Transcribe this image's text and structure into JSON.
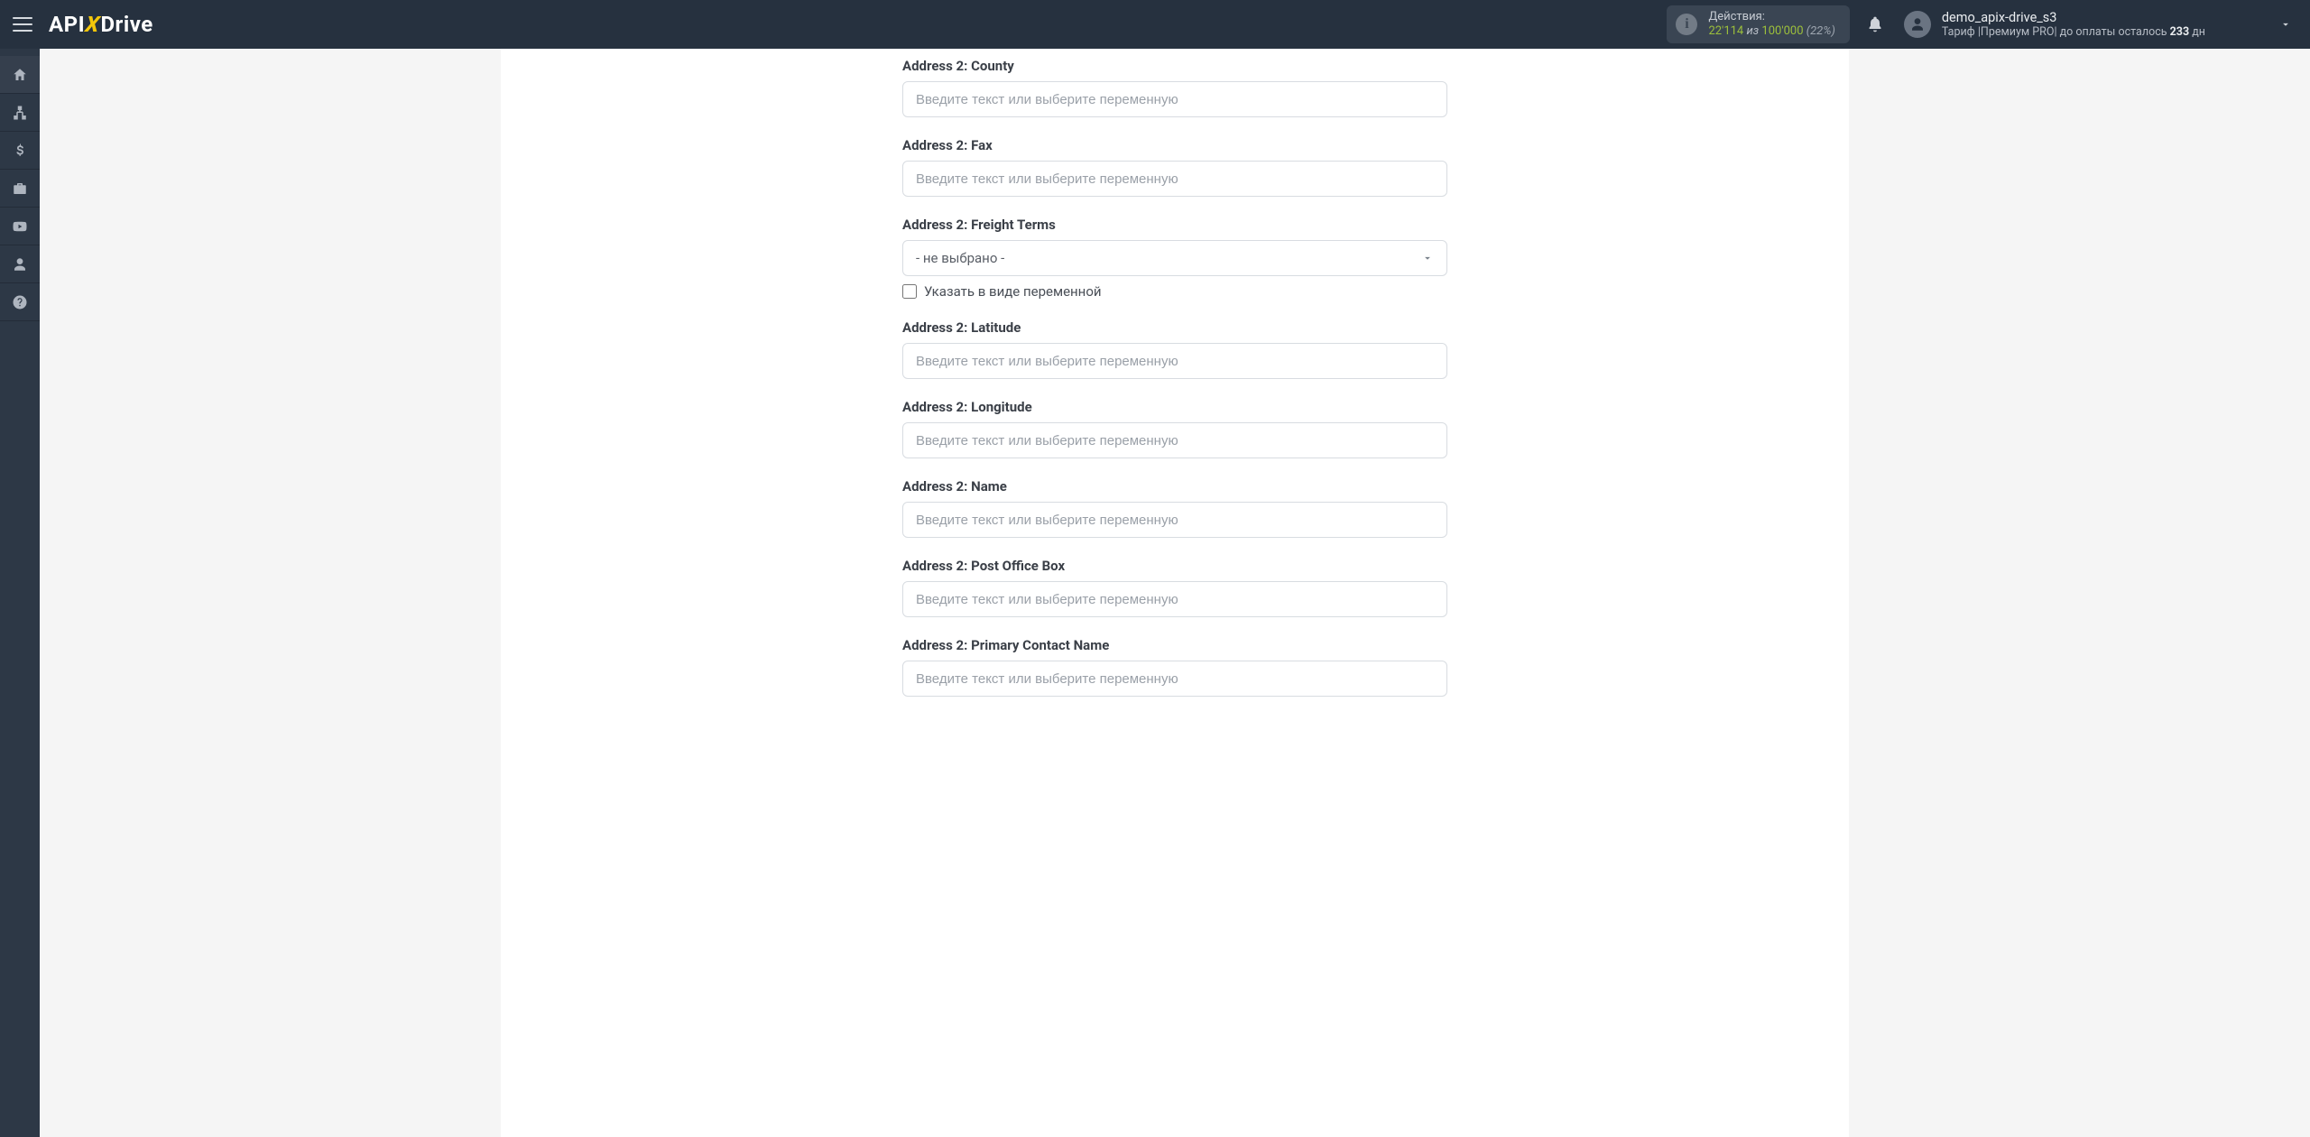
{
  "brand": {
    "part1": "API",
    "x": "X",
    "part2": "Drive"
  },
  "topbar": {
    "usage": {
      "label": "Действия:",
      "count": "22'114",
      "of": "из",
      "total": "100'000",
      "pct": "(22%)"
    },
    "account": {
      "name": "demo_apix-drive_s3",
      "tariff_prefix": "Тариф |",
      "tariff_plan": "Премиум PRO",
      "days_prefix": "| до оплаты осталось ",
      "days_value": "233",
      "days_suffix": " дн"
    }
  },
  "sidebar": {
    "items": [
      {
        "name": "home"
      },
      {
        "name": "sitemap"
      },
      {
        "name": "dollar"
      },
      {
        "name": "briefcase"
      },
      {
        "name": "youtube"
      },
      {
        "name": "user"
      },
      {
        "name": "help"
      }
    ]
  },
  "form": {
    "placeholder": "Введите текст или выберите переменную",
    "select_placeholder": "- не выбрано -",
    "variable_checkbox": "Указать в виде переменной",
    "fields": [
      {
        "key": "county",
        "label": "Address 2: County",
        "type": "text"
      },
      {
        "key": "fax",
        "label": "Address 2: Fax",
        "type": "text"
      },
      {
        "key": "freight",
        "label": "Address 2: Freight Terms",
        "type": "select"
      },
      {
        "key": "latitude",
        "label": "Address 2: Latitude",
        "type": "text"
      },
      {
        "key": "longitude",
        "label": "Address 2: Longitude",
        "type": "text"
      },
      {
        "key": "name",
        "label": "Address 2: Name",
        "type": "text"
      },
      {
        "key": "pobox",
        "label": "Address 2: Post Office Box",
        "type": "text"
      },
      {
        "key": "primarycontact",
        "label": "Address 2: Primary Contact Name",
        "type": "text"
      }
    ]
  }
}
